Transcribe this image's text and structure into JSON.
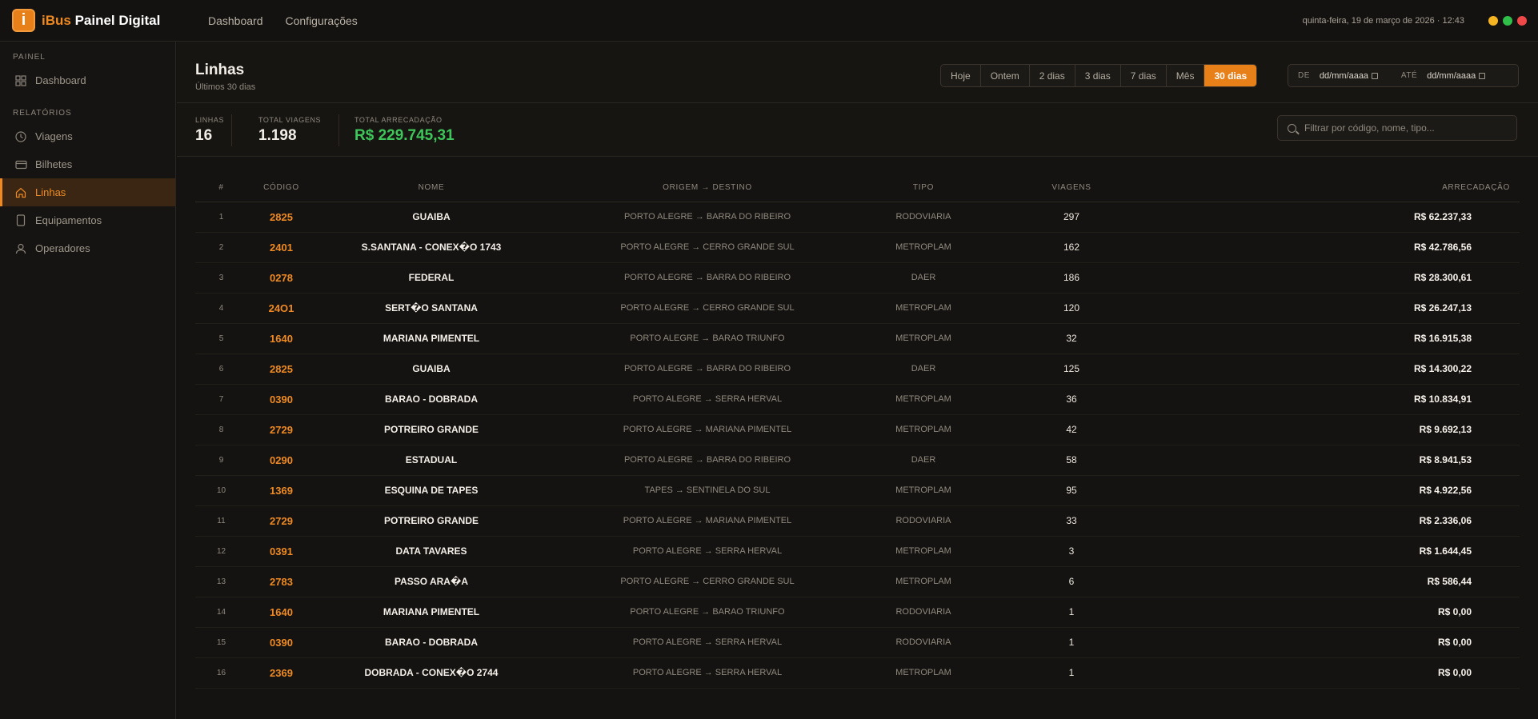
{
  "app": {
    "logo_letter": "i",
    "brand_accent": "iBus",
    "brand_rest": "Painel Digital",
    "nav": [
      "Dashboard",
      "Configurações"
    ],
    "datetime": "quinta-feira, 19 de março de 2026 · 12:43",
    "window_dots": [
      "#f5b523",
      "#2fbf4a",
      "#ef4848"
    ]
  },
  "sidebar": {
    "section_painel": "PAINEL",
    "dashboard": "Dashboard",
    "section_relatorios": "RELATÓRIOS",
    "viagens": "Viagens",
    "bilhetes": "Bilhetes",
    "linhas": "Linhas",
    "equipamentos": "Equipamentos",
    "operadores": "Operadores"
  },
  "header": {
    "title": "Linhas",
    "subtitle": "Últimos 30 dias",
    "ranges": [
      "Hoje",
      "Ontem",
      "2 dias",
      "3 dias",
      "7 dias",
      "Mês",
      "30 dias"
    ],
    "active_range": "30 dias",
    "de_label": "DE",
    "ate_label": "ATÉ",
    "date_from": "dd/mm/aaaa",
    "date_to": "dd/mm/aaaa"
  },
  "stats": {
    "linhas_label": "LINHAS",
    "linhas_value": "16",
    "viagens_label": "TOTAL VIAGENS",
    "viagens_value": "1.198",
    "arrecadacao_label": "TOTAL ARRECADAÇÃO",
    "arrecadacao_value": "R$ 229.745,31",
    "filter_placeholder": "Filtrar por código, nome, tipo..."
  },
  "table": {
    "headers": [
      "#",
      "CÓDIGO",
      "NOME",
      "ORIGEM → DESTINO",
      "TIPO",
      "VIAGENS",
      "ARRECADAÇÃO"
    ],
    "rows": [
      {
        "n": "1",
        "codigo": "2825",
        "nome": "GUAIBA",
        "rota": "PORTO ALEGRE → BARRA DO RIBEIRO",
        "tipo": "RODOVIARIA",
        "viagens": "297",
        "valor": "R$ 62.237,33"
      },
      {
        "n": "2",
        "codigo": "2401",
        "nome": "S.SANTANA - CONEX�O 1743",
        "rota": "PORTO ALEGRE → CERRO GRANDE SUL",
        "tipo": "METROPLAM",
        "viagens": "162",
        "valor": "R$ 42.786,56"
      },
      {
        "n": "3",
        "codigo": "0278",
        "nome": "FEDERAL",
        "rota": "PORTO ALEGRE → BARRA DO RIBEIRO",
        "tipo": "DAER",
        "viagens": "186",
        "valor": "R$ 28.300,61"
      },
      {
        "n": "4",
        "codigo": "24O1",
        "nome": "SERT�O SANTANA",
        "rota": "PORTO ALEGRE → CERRO GRANDE SUL",
        "tipo": "METROPLAM",
        "viagens": "120",
        "valor": "R$ 26.247,13"
      },
      {
        "n": "5",
        "codigo": "1640",
        "nome": "MARIANA PIMENTEL",
        "rota": "PORTO ALEGRE → BARAO TRIUNFO",
        "tipo": "METROPLAM",
        "viagens": "32",
        "valor": "R$ 16.915,38"
      },
      {
        "n": "6",
        "codigo": "2825",
        "nome": "GUAIBA",
        "rota": "PORTO ALEGRE → BARRA DO RIBEIRO",
        "tipo": "DAER",
        "viagens": "125",
        "valor": "R$ 14.300,22"
      },
      {
        "n": "7",
        "codigo": "0390",
        "nome": "BARAO - DOBRADA",
        "rota": "PORTO ALEGRE → SERRA HERVAL",
        "tipo": "METROPLAM",
        "viagens": "36",
        "valor": "R$ 10.834,91"
      },
      {
        "n": "8",
        "codigo": "2729",
        "nome": "POTREIRO GRANDE",
        "rota": "PORTO ALEGRE → MARIANA PIMENTEL",
        "tipo": "METROPLAM",
        "viagens": "42",
        "valor": "R$ 9.692,13"
      },
      {
        "n": "9",
        "codigo": "0290",
        "nome": "ESTADUAL",
        "rota": "PORTO ALEGRE → BARRA DO RIBEIRO",
        "tipo": "DAER",
        "viagens": "58",
        "valor": "R$ 8.941,53"
      },
      {
        "n": "10",
        "codigo": "1369",
        "nome": "ESQUINA DE TAPES",
        "rota": "TAPES → SENTINELA DO SUL",
        "tipo": "METROPLAM",
        "viagens": "95",
        "valor": "R$ 4.922,56"
      },
      {
        "n": "11",
        "codigo": "2729",
        "nome": "POTREIRO GRANDE",
        "rota": "PORTO ALEGRE → MARIANA PIMENTEL",
        "tipo": "RODOVIARIA",
        "viagens": "33",
        "valor": "R$ 2.336,06"
      },
      {
        "n": "12",
        "codigo": "0391",
        "nome": "DATA TAVARES",
        "rota": "PORTO ALEGRE → SERRA HERVAL",
        "tipo": "METROPLAM",
        "viagens": "3",
        "valor": "R$ 1.644,45"
      },
      {
        "n": "13",
        "codigo": "2783",
        "nome": "PASSO ARA�A",
        "rota": "PORTO ALEGRE → CERRO GRANDE SUL",
        "tipo": "METROPLAM",
        "viagens": "6",
        "valor": "R$ 586,44"
      },
      {
        "n": "14",
        "codigo": "1640",
        "nome": "MARIANA PIMENTEL",
        "rota": "PORTO ALEGRE → BARAO TRIUNFO",
        "tipo": "RODOVIARIA",
        "viagens": "1",
        "valor": "R$ 0,00"
      },
      {
        "n": "15",
        "codigo": "0390",
        "nome": "BARAO - DOBRADA",
        "rota": "PORTO ALEGRE → SERRA HERVAL",
        "tipo": "RODOVIARIA",
        "viagens": "1",
        "valor": "R$ 0,00"
      },
      {
        "n": "16",
        "codigo": "2369",
        "nome": "DOBRADA - CONEX�O 2744",
        "rota": "PORTO ALEGRE → SERRA HERVAL",
        "tipo": "METROPLAM",
        "viagens": "1",
        "valor": "R$ 0,00"
      }
    ]
  },
  "colors": {
    "accent": "#ef8a22",
    "money_total": "#3ec65a",
    "background": "#151311"
  }
}
